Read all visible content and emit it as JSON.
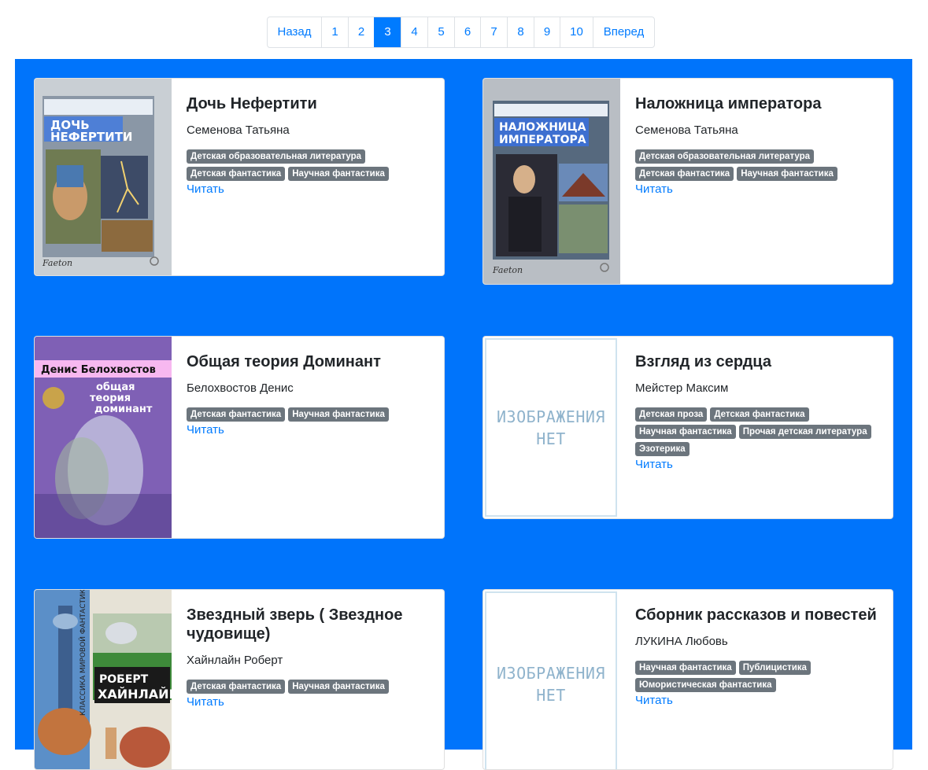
{
  "pagination": {
    "prev": "Назад",
    "pages": [
      "1",
      "2",
      "3",
      "4",
      "5",
      "6",
      "7",
      "8",
      "9",
      "10"
    ],
    "active": "3",
    "next": "Вперед"
  },
  "colors": {
    "accent": "#007bff",
    "background": "#0074fb",
    "tag": "#6c757d"
  },
  "read_label": "Читать",
  "no_image": {
    "line1": "ИЗОБРАЖЕНИЯ",
    "line2": "НЕТ"
  },
  "books": [
    {
      "title": "Дочь Нефертити",
      "author": "Семенова Татьяна",
      "tags": [
        "Детская образовательная литература",
        "Детская фантастика",
        "Научная фантастика"
      ],
      "cover": {
        "type": "image",
        "heading": "ДОЧЬ НЕФЕРТИТИ",
        "author": "Татьяна Семенова",
        "publisher": "Faeton"
      }
    },
    {
      "title": "Наложница императора",
      "author": "Семенова Татьяна",
      "tags": [
        "Детская образовательная литература",
        "Детская фантастика",
        "Научная фантастика"
      ],
      "cover": {
        "type": "image",
        "heading": "НАЛОЖНИЦА ИМПЕРАТОРА",
        "author": "Татьяна Семенова",
        "publisher": "Faeton"
      }
    },
    {
      "title": "Общая теория Доминант",
      "author": "Белохвостов Денис",
      "tags": [
        "Детская фантастика",
        "Научная фантастика"
      ],
      "cover": {
        "type": "image",
        "heading": "Денис Белохвостов",
        "subheading": "общая теория доминант"
      }
    },
    {
      "title": "Взгляд из сердца",
      "author": "Мейстер Максим",
      "tags": [
        "Детская проза",
        "Детская фантастика",
        "Научная фантастика",
        "Прочая детская литература",
        "Эзотерика"
      ],
      "cover": {
        "type": "none"
      }
    },
    {
      "title": "Звездный зверь ( Звездное чудовище)",
      "author": "Хайнлайн Роберт",
      "tags": [
        "Детская фантастика",
        "Научная фантастика"
      ],
      "cover": {
        "type": "image",
        "heading": "РОБЕРТ ХАЙНЛАЙН",
        "series": "КЛАССИКА МИРОВОЙ ФАНТАСТИКИ"
      }
    },
    {
      "title": "Сборник рассказов и повестей",
      "author": "ЛУКИНА Любовь",
      "tags": [
        "Научная фантастика",
        "Публицистика",
        "Юмористическая фантастика"
      ],
      "cover": {
        "type": "none"
      }
    }
  ]
}
